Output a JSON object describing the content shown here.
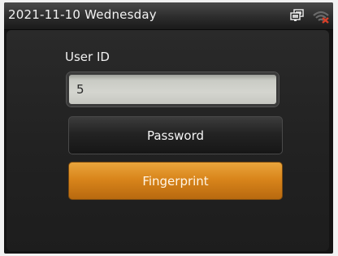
{
  "status_bar": {
    "date_text": "2021-11-10 Wednesday",
    "icons": [
      "network-icon",
      "wifi-disconnected-icon"
    ]
  },
  "login": {
    "field_label": "User ID",
    "user_id_value": "5",
    "buttons": {
      "password": "Password",
      "fingerprint": "Fingerprint"
    }
  },
  "colors": {
    "accent": "#d9851b",
    "wifi_error": "#d8402a"
  }
}
